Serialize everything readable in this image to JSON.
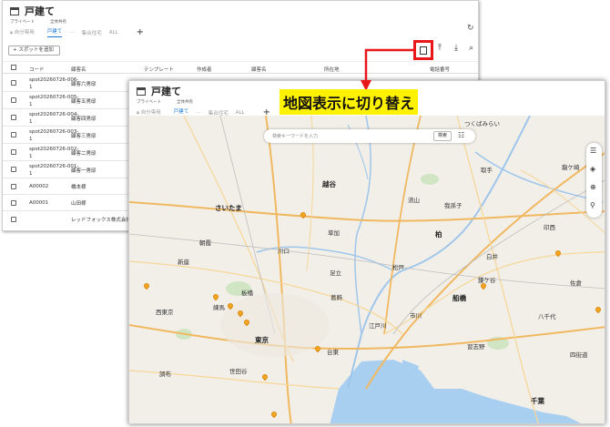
{
  "back_window": {
    "title": "戸建て",
    "private_label": "プライベート",
    "private_tabs": [
      "自分専用"
    ],
    "shared_label": "全体共有",
    "shared_tabs": [
      "戸建て",
      "集合住宅",
      "ALL"
    ],
    "tab_more": "⋯",
    "add_spot": "+ スポットを追加",
    "columns": [
      "コード",
      "顧客名",
      "テンプレート",
      "作成者",
      "顧客名",
      "所在地",
      "電話番号"
    ],
    "rows": [
      {
        "code": "spot20260726-006-1",
        "name": "顧客六男邸"
      },
      {
        "code": "spot20260726-005-1",
        "name": "顧客五男邸"
      },
      {
        "code": "spot20260726-004-1",
        "name": "顧客四男邸"
      },
      {
        "code": "spot20260726-003-1",
        "name": "顧客三男邸"
      },
      {
        "code": "spot20260726-002-1",
        "name": "顧客二男邸"
      },
      {
        "code": "spot20260726-001-1",
        "name": "顧客一男邸"
      },
      {
        "code": "A00002",
        "name": "橋本様"
      },
      {
        "code": "A00001",
        "name": "山田様"
      },
      {
        "code": "",
        "name": "レッドフォックス株式会社"
      }
    ]
  },
  "front_window": {
    "title": "戸建て",
    "private_label": "プライベート",
    "private_tabs": [
      "自分専用"
    ],
    "shared_label": "全体共有",
    "shared_tabs": [
      "戸建て",
      "集合住宅",
      "ALL"
    ],
    "tab_more": "⋯",
    "search_placeholder": "検索キーワードを入力",
    "search_button": "検索"
  },
  "annotation": {
    "banner": "地図表示に切り替え",
    "highlight_color": "#e8181a",
    "banner_color": "#fff200"
  },
  "map": {
    "places": [
      "さいたま",
      "越谷",
      "草加",
      "川口",
      "足立",
      "松戸",
      "柏",
      "流山",
      "我孫子",
      "取手",
      "つくばみらい",
      "龍ケ崎",
      "新座",
      "板橋",
      "西東京",
      "練馬",
      "葛飾",
      "江戸川",
      "市川",
      "船橋",
      "東京",
      "台東",
      "世田谷",
      "習志野",
      "八千代",
      "印西",
      "白井",
      "佐倉",
      "千葉",
      "四街道",
      "調布",
      "朝霞",
      "鎌ケ谷"
    ]
  }
}
